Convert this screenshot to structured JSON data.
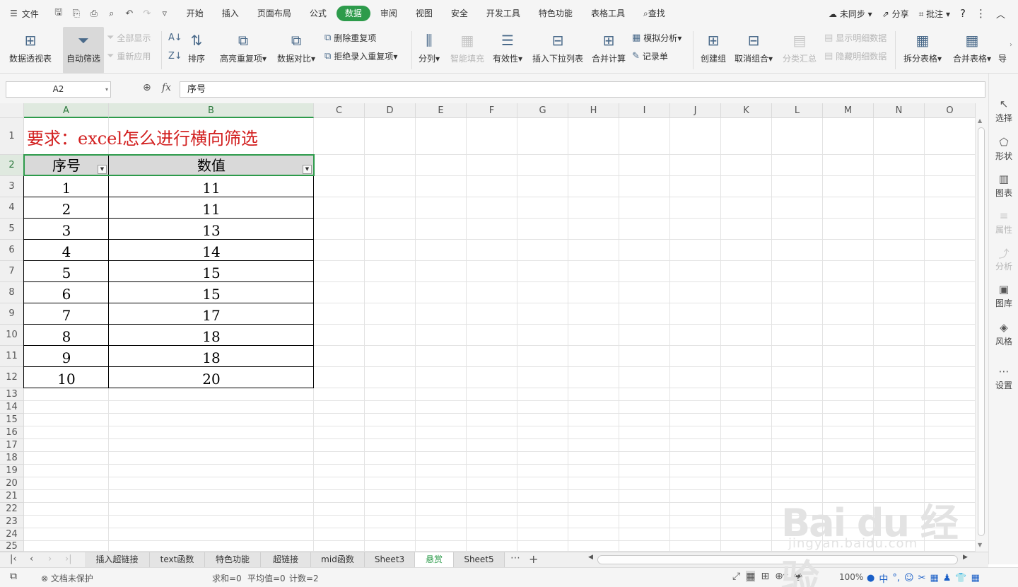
{
  "menubar": {
    "file_label": "文件",
    "tabs": [
      "开始",
      "插入",
      "页面布局",
      "公式",
      "数据",
      "审阅",
      "视图",
      "安全",
      "开发工具",
      "特色功能",
      "表格工具"
    ],
    "active_tab": "数据",
    "search_label": "查找",
    "sync_label": "未同步",
    "share_label": "分享",
    "comment_label": "批注",
    "help_label": "?"
  },
  "ribbon": {
    "pivot": "数据透视表",
    "autofilter": "自动筛选",
    "show_all": "全部显示",
    "reapply": "重新应用",
    "sort": "排序",
    "highlight_dup": "高亮重复项",
    "data_compare": "数据对比",
    "remove_dup": "删除重复项",
    "reject_dup": "拒绝录入重复项",
    "split_column": "分列",
    "smart_fill": "智能填充",
    "validity": "有效性",
    "insert_dropdown": "插入下拉列表",
    "consolidate": "合并计算",
    "what_if": "模拟分析",
    "record_form": "记录单",
    "create_group": "创建组",
    "ungroup": "取消组合",
    "subtotal": "分类汇总",
    "show_detail": "显示明细数据",
    "hide_detail": "隐藏明细数据",
    "split_table": "拆分表格",
    "merge_table": "合并表格",
    "more": "导"
  },
  "formula_bar": {
    "cell_ref": "A2",
    "fx_label": "fx",
    "content": "序号"
  },
  "sheet": {
    "columns": [
      "A",
      "B",
      "C",
      "D",
      "E",
      "F",
      "G",
      "H",
      "I",
      "J",
      "K",
      "L",
      "M",
      "N",
      "O"
    ],
    "row_numbers": [
      "1",
      "2",
      "3",
      "4",
      "5",
      "6",
      "7",
      "8",
      "9",
      "10",
      "11",
      "12",
      "13",
      "14",
      "15",
      "16",
      "17",
      "18",
      "19",
      "20",
      "21",
      "22",
      "23",
      "24",
      "25"
    ],
    "title": "要求：excel怎么进行横向筛选",
    "header": [
      "序号",
      "数值"
    ],
    "rows": [
      [
        "1",
        "11"
      ],
      [
        "2",
        "11"
      ],
      [
        "3",
        "13"
      ],
      [
        "4",
        "14"
      ],
      [
        "5",
        "15"
      ],
      [
        "6",
        "15"
      ],
      [
        "7",
        "17"
      ],
      [
        "8",
        "18"
      ],
      [
        "9",
        "18"
      ],
      [
        "10",
        "20"
      ]
    ]
  },
  "side_panel": [
    "选择",
    "形状",
    "图表",
    "属性",
    "分析",
    "图库",
    "风格",
    "设置"
  ],
  "sheet_tabs": [
    "插入超链接",
    "text函数",
    "特色功能",
    "超链接",
    "mid函数",
    "Sheet3",
    "悬赏",
    "Sheet5"
  ],
  "active_sheet": "悬赏",
  "status": {
    "protection": "文档未保护",
    "sum": "求和=0",
    "average": "平均值=0",
    "count": "计数=2",
    "zoom": "100%",
    "ime_mode": "中"
  },
  "watermark": {
    "brand": "Bai du 经验",
    "url": "jingyan.baidu.com"
  },
  "colors": {
    "accent": "#2d9b4b",
    "title_red": "#d21f1f"
  }
}
